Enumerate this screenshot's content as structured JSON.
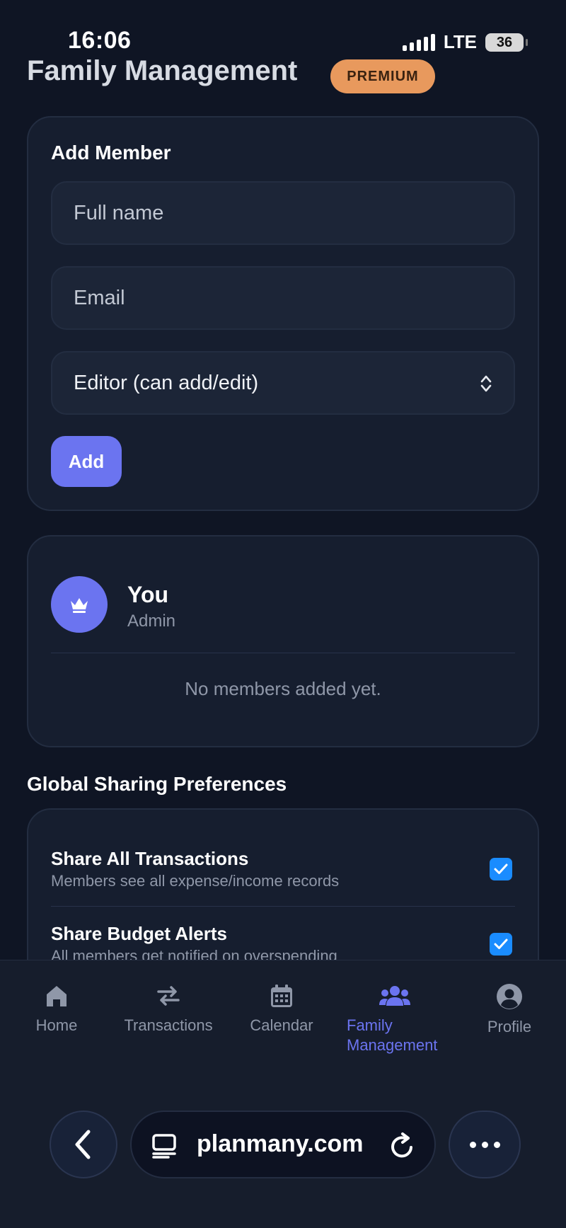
{
  "status_bar": {
    "time": "16:06",
    "network": "LTE",
    "battery": "36"
  },
  "header": {
    "title": "Family Management",
    "badge": "PREMIUM"
  },
  "add_member": {
    "title": "Add Member",
    "name_placeholder": "Full name",
    "email_placeholder": "Email",
    "role_selected": "Editor (can add/edit)",
    "add_label": "Add"
  },
  "members": {
    "current_user": {
      "name": "You",
      "role": "Admin"
    },
    "empty_text": "No members added yet."
  },
  "sharing": {
    "title": "Global Sharing Preferences",
    "items": [
      {
        "title": "Share All Transactions",
        "description": "Members see all expense/income records",
        "checked": true
      },
      {
        "title": "Share Budget Alerts",
        "description": "All members get notified on overspending",
        "checked": true
      }
    ]
  },
  "nav": {
    "items": [
      {
        "label": "Home",
        "icon": "home-icon"
      },
      {
        "label": "Transactions",
        "icon": "transfer-icon"
      },
      {
        "label": "Calendar",
        "icon": "calendar-icon"
      },
      {
        "label": "Family Management",
        "icon": "users-icon",
        "active": true
      },
      {
        "label": "Profile",
        "icon": "user-circle-icon"
      }
    ]
  },
  "browser": {
    "url": "planmany.com"
  },
  "colors": {
    "accent": "#6b74f0",
    "background": "#0f1524",
    "card": "#161e2f",
    "premium": "#e8995d",
    "checkbox": "#1a8cff"
  }
}
